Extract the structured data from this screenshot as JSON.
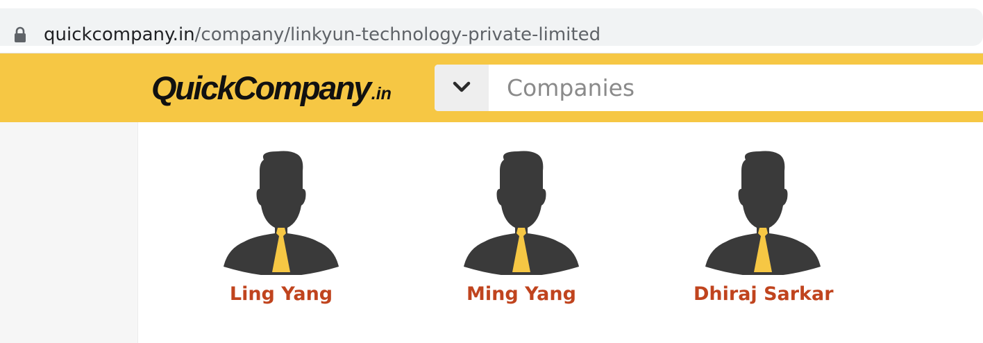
{
  "browser": {
    "url_domain": "quickcompany.in",
    "url_path": "/company/linkyun-technology-private-limited",
    "lock_icon": "lock-icon"
  },
  "header": {
    "logo_main": "QuickCompany",
    "logo_suffix": ".in",
    "search_placeholder": "Companies",
    "dropdown_icon": "chevron-down-icon",
    "brand_color": "#f6c744"
  },
  "directors": [
    {
      "name": "Ling Yang",
      "avatar": "person-avatar-icon"
    },
    {
      "name": "Ming Yang",
      "avatar": "person-avatar-icon"
    },
    {
      "name": "Dhiraj Sarkar",
      "avatar": "person-avatar-icon"
    }
  ],
  "colors": {
    "name_link": "#c0441e",
    "avatar_body": "#3a3a3a",
    "tie": "#f6c744"
  }
}
